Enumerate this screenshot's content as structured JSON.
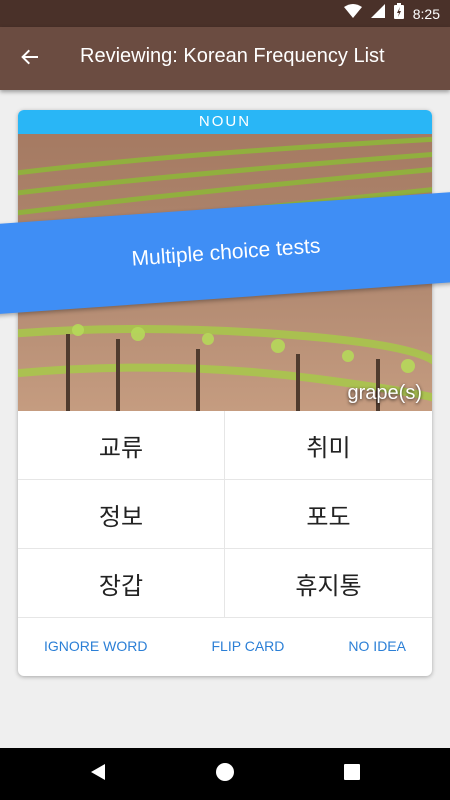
{
  "status_bar": {
    "time": "8:25",
    "icons": [
      "wifi-icon",
      "signal-icon",
      "battery-icon"
    ]
  },
  "app_bar": {
    "title": "Reviewing: Korean Frequency List",
    "back_icon": "arrow-back-icon"
  },
  "card": {
    "part_of_speech": "NOUN",
    "translation": "grape(s)",
    "choices": [
      "교류",
      "취미",
      "정보",
      "포도",
      "장갑",
      "휴지통"
    ],
    "actions": {
      "ignore": "IGNORE WORD",
      "flip": "FLIP CARD",
      "no_idea": "NO IDEA"
    }
  },
  "banner": {
    "text": "Multiple choice tests"
  },
  "nav_bar": {
    "icons": [
      "back-triangle-icon",
      "home-circle-icon",
      "recents-square-icon"
    ]
  },
  "colors": {
    "status_bar": "#4a3129",
    "app_bar": "#6b4c41",
    "pos_bar": "#29b6f6",
    "banner": "#3f8ef5",
    "action_text": "#2b7fd6"
  }
}
